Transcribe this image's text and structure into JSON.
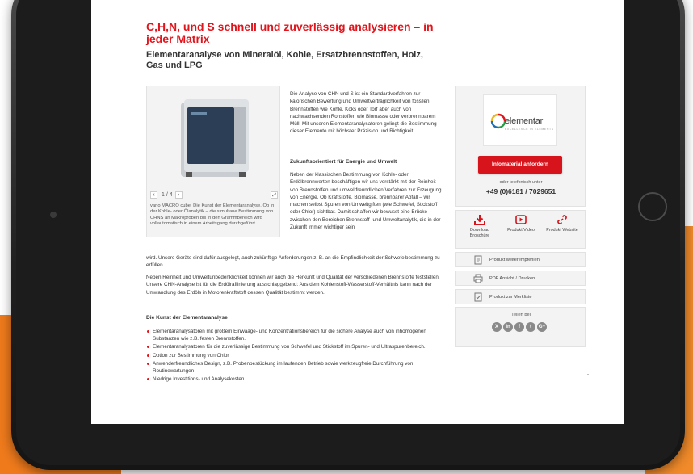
{
  "colors": {
    "accent": "#e3141b",
    "button": "#d7141c",
    "panel": "#f3f3f3",
    "icon_red": "#d7141c"
  },
  "header": {
    "title": "C,H,N, und S schnell und zuverlässig analysieren – in jeder Matrix",
    "subtitle": "Elementaranalyse von Mineralöl, Kohle, Ersatzbrennstoffen, Holz, Gas und LPG"
  },
  "gallery": {
    "pager": "1 / 4",
    "caption": "vario MACRO cube: Die Kunst der Elementaranalyse. Ob in der Kohle- oder Ölanalytik – die simultane Bestimmung von CHNS an Makroproben bis in den Grammbereich wird vollautomatisch in einem Arbeitsgang durchgeführt.",
    "icons": {
      "prev": "chevron-left-icon",
      "next": "chevron-right-icon",
      "expand": "expand-icon"
    }
  },
  "content": {
    "intro": "Die Analyse von CHN und S ist ein Standardverfahren zur kalorischen Bewertung und Umweltverträglichkeit von fossilen Brennstoffen wie Kohle, Koks oder Torf aber auch von nachwachsenden Rohstoffen wie Biomasse oder verbrennbarem Müll. Mit unseren Elementaranalysatoren gelingt die Bestimmung dieser Elemente mit höchster Präzision und Richtigkeit.",
    "heading1": "Zukunftsorientiert für Energie und Umwelt",
    "para2": "Neben der klassischen Bestimmung von Kohle- oder Erdölbrennwerten beschäftigen wir uns verstärkt mit der Reinheit von Brennstoffen und umweltfreundlichen Verfahren zur Erzeugung von Energie. Ob Kraftstoffe, Biomasse, brennbarer Abfall – wir machen selbst Spuren von Umweltgiften (wie Schwefel, Stickstoff oder Chlor) sichtbar. Damit schaffen wir bewusst eine Brücke zwischen den Bereichen Brennstoff- und Umweltanalytik, die in der Zukunft immer wichtiger sein",
    "para2_cont": "wird. Unsere Geräte sind dafür ausgelegt, auch zukünftige Anforderungen z. B. an die Empfindlichkeit der Schwefelbestimmung zu erfüllen.",
    "para3": "Neben Reinheit und Umweltunbedenklichkeit können wir auch die Herkunft und Qualität der verschiedenen Brennstoffe feststellen. Unsere CHN-Analyse ist für die Erdölraffinierung ausschlaggebend: Aus dem Kohlenstoff-Wasserstoff-Verhältnis kann nach der Umwandlung des Erdöls in Motorenkraftstoff dessen Qualität bestimmt werden.",
    "heading2": "Die Kunst der Elementaranalyse",
    "bullets": [
      "Elementaranalysatoren mit großem Einwaage- und Konzentrationsbereich für die sichere Analyse auch von inhomogenen Substanzen wie z.B. festen Brennstoffen.",
      "Elementaranalysatoren für die zuverlässige Bestimmung von Schwefel und Stickstoff im Spuren- und Ultraspurenbereich.",
      "Option zur Bestimmung von Chlor",
      "Anwenderfreundliches Design, z.B. Probenbestückung im laufenden Betrieb sowie werkzeugfreie Durchführung von Routinewartungen",
      "Niedrige Investitions- und Analysekosten"
    ]
  },
  "sidebar": {
    "logo_text": "elementar",
    "logo_tagline": "EXCELLENCE IN ELEMENTS",
    "info_button": "Infomaterial anfordern",
    "phone_label": "oder telefonisch unter",
    "phone": "+49 (0)6181 / 7029651",
    "downloads": [
      {
        "label": "Download Broschüre",
        "icon": "download-icon"
      },
      {
        "label": "Produkt Video",
        "icon": "play-icon"
      },
      {
        "label": "Produkt Website",
        "icon": "link-icon"
      }
    ],
    "actions": [
      {
        "label": "Produkt weiterempfehlen",
        "icon": "recommend-icon"
      },
      {
        "label": "PDF Ansicht / Drucken",
        "icon": "print-icon"
      },
      {
        "label": "Produkt zur Merkliste",
        "icon": "bookmark-icon"
      }
    ],
    "share_label": "Teilen bei",
    "social": [
      {
        "glyph": "X",
        "icon": "xing-icon"
      },
      {
        "glyph": "in",
        "icon": "linkedin-icon"
      },
      {
        "glyph": "f",
        "icon": "facebook-icon"
      },
      {
        "glyph": "t",
        "icon": "twitter-icon"
      },
      {
        "glyph": "G+",
        "icon": "googleplus-icon"
      }
    ]
  }
}
